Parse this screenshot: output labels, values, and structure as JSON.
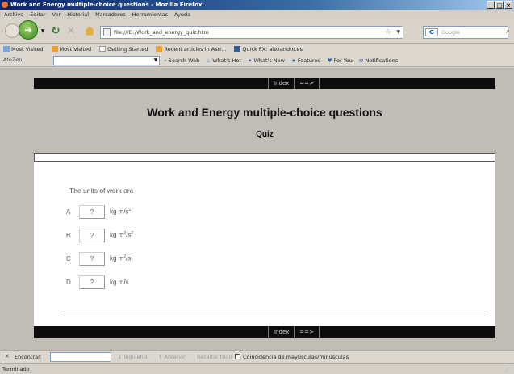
{
  "window": {
    "title": "Work and Energy multiple-choice questions - Mozilla Firefox",
    "buttons": [
      "_",
      "□",
      "×"
    ]
  },
  "menu": [
    "Archivo",
    "Editar",
    "Ver",
    "Historial",
    "Marcadores",
    "Herramientas",
    "Ayuda"
  ],
  "nav": {
    "url": "file:///D:/Work_and_energy_quiz.htm",
    "search_placeholder": "Google",
    "search_engine_icon": "G"
  },
  "bookmarks": [
    "Most Visited",
    "Most Visited",
    "Getting Started",
    "Recent articles in Astr...",
    "Quick FX: alexandro.es"
  ],
  "addon_bar": {
    "logo": "AtoZen",
    "items": [
      "Search Web",
      "What's Hot",
      "What's New",
      "Featured",
      "For You",
      "Notifications"
    ]
  },
  "page": {
    "nav_index": "Index",
    "nav_next": "==>",
    "title": "Work and Energy multiple-choice questions",
    "subtitle": "Quiz",
    "question": "The units of work are",
    "options": [
      {
        "letter": "A",
        "button": "?",
        "unit": "kg m/s",
        "sup": "2"
      },
      {
        "letter": "B",
        "button": "?",
        "unit": "kg m",
        "sup": "2",
        "unit_tail": "/s",
        "sup_tail": "2"
      },
      {
        "letter": "C",
        "button": "?",
        "unit": "kg m",
        "sup": "2",
        "unit_tail": "/s",
        "sup_tail": ""
      },
      {
        "letter": "D",
        "button": "?",
        "unit": "kg m/s",
        "sup": "",
        "unit_tail": "",
        "sup_tail": ""
      }
    ]
  },
  "find_bar": {
    "close": "×",
    "label": "Encontrar:",
    "next": "Siguiente",
    "previous": "Anterior",
    "highlight": "Resaltar todo",
    "match_case": "Coincidencia de mayúsculas/minúsculas"
  },
  "status": "Terminado",
  "colors": {
    "titlebar": "#0a246a",
    "nav_bar_bg": "#0c0c0c",
    "content_bg": "#ffffff",
    "page_bg": "#c0bcb6"
  }
}
